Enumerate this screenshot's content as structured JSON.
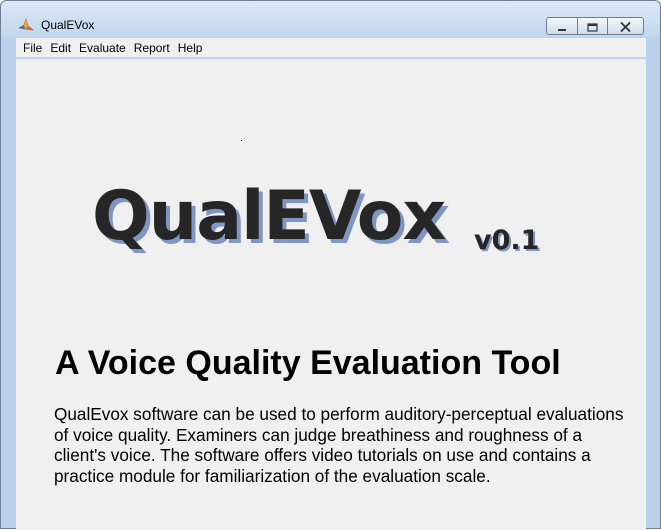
{
  "window": {
    "title": "QualEVox"
  },
  "menubar": {
    "items": [
      {
        "label": "File"
      },
      {
        "label": "Edit"
      },
      {
        "label": "Evaluate"
      },
      {
        "label": "Report"
      },
      {
        "label": "Help"
      }
    ]
  },
  "main": {
    "logo_text": "QualEVox",
    "version": "v0.1",
    "headline": "A Voice Quality Evaluation Tool",
    "description": "QualEvox software can be used to perform auditory-perceptual evaluations of voice quality. Examiners can judge breathiness and roughness of a client's voice. The software offers video tutorials on use and contains a practice module for familiarization of the evaluation scale."
  },
  "colors": {
    "logo_text": "#262626",
    "logo_shadow": "#7f96c4",
    "window_frame": "#b9d1ea",
    "client_bg": "#f0f0f0"
  },
  "icons": {
    "app": "matlab-icon",
    "minimize": "minimize-icon",
    "maximize": "maximize-icon",
    "close": "close-icon"
  }
}
